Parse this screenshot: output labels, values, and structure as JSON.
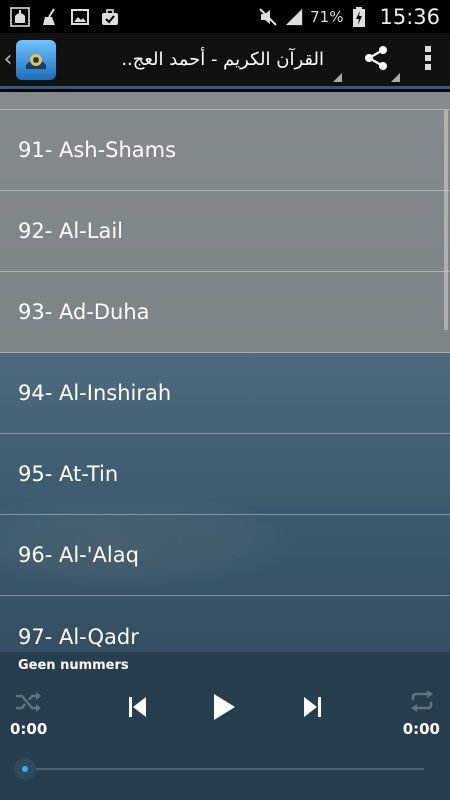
{
  "status_bar": {
    "icons": [
      "mosque-notification-icon",
      "broom-icon",
      "image-icon",
      "briefcase-check-icon"
    ],
    "battery_text": "71%",
    "time": "15:36"
  },
  "action_bar": {
    "title": "القرآن الكريم - أحمد العج..",
    "back_icon": "chevron-left-icon",
    "app_icon": "quran-app-icon",
    "share_icon": "share-icon",
    "overflow_icon": "more-vert-icon"
  },
  "list": {
    "items": [
      {
        "label": "91- Ash-Shams",
        "highlighted": true
      },
      {
        "label": "92- Al-Lail",
        "highlighted": true
      },
      {
        "label": "93- Ad-Duha",
        "highlighted": true
      },
      {
        "label": "94- Al-Inshirah",
        "highlighted": false
      },
      {
        "label": "95- At-Tin",
        "highlighted": false
      },
      {
        "label": "96- Al-'Alaq",
        "highlighted": false
      },
      {
        "label": "97- Al-Qadr",
        "highlighted": false
      }
    ]
  },
  "player": {
    "now_playing": "Geen nummers",
    "elapsed": "0:00",
    "duration": "0:00",
    "progress_fraction": 0,
    "accent_color": "#33b5e5"
  }
}
